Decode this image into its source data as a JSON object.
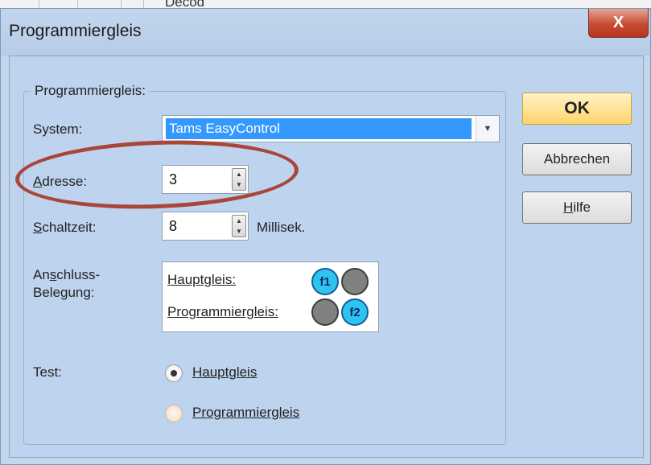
{
  "background_window": {
    "partial_text": "Decod"
  },
  "dialog": {
    "title": "Programmiergleis",
    "close_label": "X"
  },
  "group": {
    "label": "Programmiergleis:",
    "system": {
      "label": "System:",
      "value": "Tams EasyControl"
    },
    "address": {
      "label_accel": "A",
      "label_rest": "dresse:",
      "value": "3"
    },
    "switch_time": {
      "label_accel": "S",
      "label_rest": "chaltzeit:",
      "value": "8",
      "unit": "Millisek."
    },
    "connection": {
      "label_line1_pre": "An",
      "label_line1_accel": "s",
      "label_line1_post": "chluss-",
      "label_line2": "Belegung:",
      "main_track_label": "Hauptgleis:",
      "prog_track_label": "Programmiergleis:",
      "f1": "f1",
      "f2": "f2"
    },
    "test": {
      "label": "Test:",
      "option1": "Hauptgleis",
      "option2": "Programmiergleis",
      "selected": "Hauptgleis"
    }
  },
  "buttons": {
    "ok": "OK",
    "cancel": "Abbrechen",
    "help_accel": "H",
    "help_rest": "ilfe"
  },
  "colors": {
    "dialog_bg": "#bed3ee",
    "selection": "#3399ff",
    "annotation_oval": "#a9463a"
  }
}
